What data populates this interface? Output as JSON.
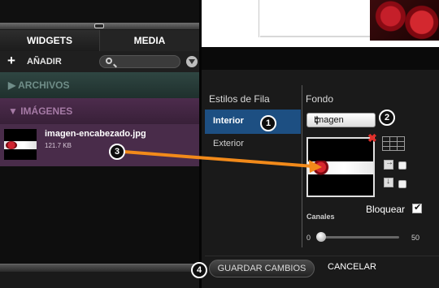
{
  "tabs": {
    "widgets": "WIDGETS",
    "media": "MEDIA"
  },
  "toolbar": {
    "add_label": "AÑADIR",
    "add_icon": "+",
    "search_placeholder": ""
  },
  "sections": {
    "archivos": "▶ ARCHIVOS",
    "imagenes": "▼ IMÁGENES"
  },
  "image_item": {
    "filename": "imagen-encabezado.jpg",
    "size": "121.7 KB"
  },
  "row_styles": {
    "title": "Estilos de Fila",
    "items": [
      "Interior",
      "Exterior"
    ],
    "selected": "Interior"
  },
  "background": {
    "title": "Fondo",
    "type_select": "Imagen",
    "lock_label": "Bloquear",
    "lock_checked": true,
    "channels_label": "Canales",
    "slider_min": "0",
    "slider_max": "50",
    "slider_value": 0
  },
  "footer": {
    "save_label": "GUARDAR CAMBIOS",
    "cancel_label": "CANCELAR"
  },
  "callouts": [
    "1",
    "2",
    "3",
    "4"
  ],
  "colors": {
    "selected_row": "#1d4f82",
    "arrow": "#f28a1a",
    "delete_icon": "#e0302b"
  }
}
